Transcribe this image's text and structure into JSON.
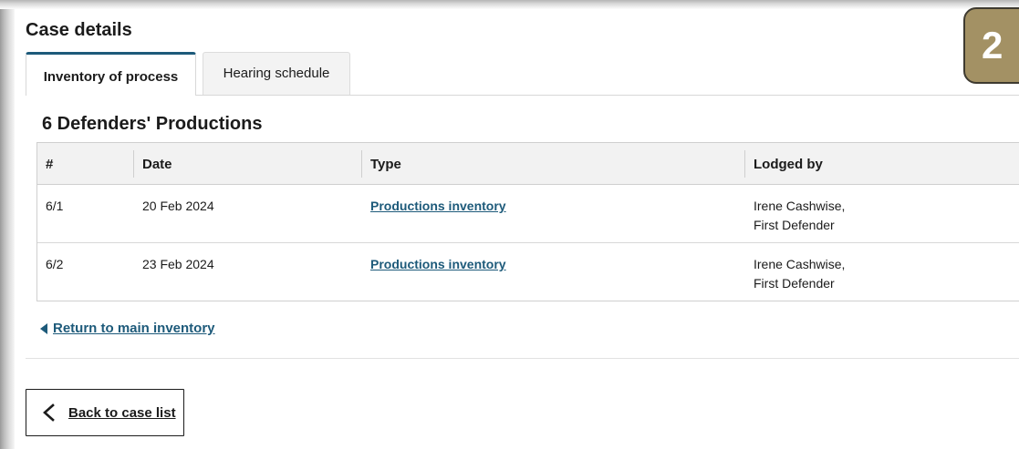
{
  "page": {
    "title": "Case details"
  },
  "tabs": [
    {
      "label": "Inventory of process",
      "active": true
    },
    {
      "label": "Hearing schedule",
      "active": false
    }
  ],
  "section": {
    "heading": "6 Defenders' Productions"
  },
  "table": {
    "columns": [
      "#",
      "Date",
      "Type",
      "Lodged by"
    ],
    "rows": [
      {
        "num": "6/1",
        "date": "20 Feb 2024",
        "type": "Productions inventory",
        "lodged_by_name": "Irene Cashwise,",
        "lodged_by_role": "First Defender"
      },
      {
        "num": "6/2",
        "date": "23 Feb 2024",
        "type": "Productions inventory",
        "lodged_by_name": "Irene Cashwise,",
        "lodged_by_role": "First Defender"
      }
    ]
  },
  "links": {
    "return_label": "Return to main inventory",
    "back_label": "Back to case list"
  },
  "badge": {
    "step_number": "2"
  },
  "colors": {
    "link": "#1d5a7a",
    "tab_accent": "#1d5a7a",
    "badge_fill": "#a39164"
  },
  "icons": {
    "return": "triangle-left-icon",
    "back": "chevron-left-icon"
  }
}
